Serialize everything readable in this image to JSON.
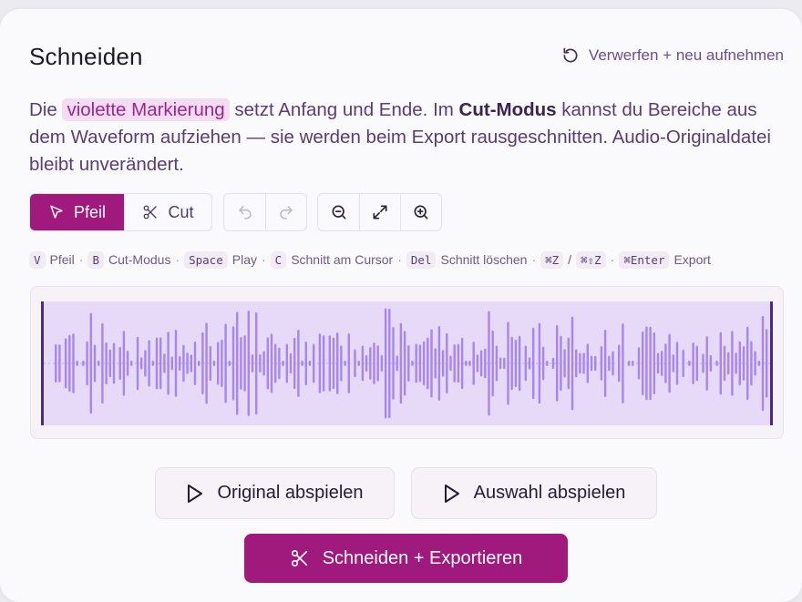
{
  "header": {
    "title": "Schneiden",
    "discard_label": "Verwerfen + neu aufnehmen"
  },
  "description": {
    "prefix": "Die",
    "highlight": "violette Markierung",
    "part2": "setzt Anfang und Ende. Im",
    "bold": "Cut-Modus",
    "part3": "kannst du Bereiche aus dem Waveform aufziehen — sie werden beim Export rausgeschnitten. Audio-Originaldatei bleibt unverändert."
  },
  "toolbar": {
    "pfeil_label": "Pfeil",
    "cut_label": "Cut"
  },
  "shortcuts": [
    {
      "key": "V",
      "label": "Pfeil"
    },
    {
      "key": "B",
      "label": "Cut-Modus"
    },
    {
      "key": "Space",
      "label": "Play"
    },
    {
      "key": "C",
      "label": "Schnitt am Cursor"
    },
    {
      "key": "Del",
      "label": "Schnitt löschen"
    },
    {
      "key": "⌘Z",
      "key2": "⌘⇧Z"
    },
    {
      "key": "⌘Enter",
      "label": "Export"
    }
  ],
  "buttons": {
    "play_original": "Original abspielen",
    "play_selection": "Auswahl abspielen",
    "export": "Schneiden + Exportieren"
  },
  "colors": {
    "accent": "#a0197c",
    "selection_fill": "#e6daf8",
    "wave_bar": "#a886ec",
    "handle": "#4a2a82",
    "highlight_bg": "#f4dcf2"
  },
  "icons": {
    "discard": "rotate-ccw-icon",
    "pfeil": "cursor-arrow-icon",
    "cut": "scissors-icon",
    "undo": "undo-icon",
    "redo": "redo-icon",
    "zoom_out": "zoom-out-icon",
    "fit": "expand-icon",
    "zoom_in": "zoom-in-icon",
    "play": "play-icon"
  }
}
